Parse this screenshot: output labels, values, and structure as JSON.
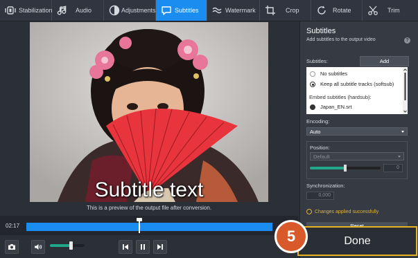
{
  "toolbar": {
    "items": [
      {
        "label": "Stabilization",
        "icon": "stabilization-icon"
      },
      {
        "label": "Audio",
        "icon": "music-note-icon"
      },
      {
        "label": "Adjustments",
        "icon": "contrast-icon"
      },
      {
        "label": "Subtitles",
        "icon": "speech-bubble-icon",
        "active": true
      },
      {
        "label": "Watermark",
        "icon": "watermark-icon"
      },
      {
        "label": "Crop",
        "icon": "crop-icon"
      },
      {
        "label": "Rotate",
        "icon": "rotate-icon"
      },
      {
        "label": "Trim",
        "icon": "scissors-icon"
      }
    ]
  },
  "preview": {
    "subtitle_text": "Subtitle text",
    "caption": "This is a preview of the output file after conversion."
  },
  "timeline": {
    "time": "02:17",
    "position": 0.46
  },
  "controls": {
    "volume_level": 0.6
  },
  "panel": {
    "title": "Subtitles",
    "subtitle": "Add subtitles to the output video",
    "help": "?",
    "subtitles_label": "Subtitles:",
    "add_button": "Add",
    "options": [
      {
        "label": "No subtitles",
        "state": "off"
      },
      {
        "label": "Keep all subtitle tracks (softsub)",
        "state": "on"
      }
    ],
    "embed_header": "Embed subtitles (hardsub):",
    "embed_items": [
      {
        "label": "Japan_EN.srt"
      }
    ],
    "encoding_label": "Encoding:",
    "encoding_value": "Auto",
    "position_label": "Position:",
    "position_value": "Default",
    "position_slider": 0.5,
    "position_number": "0",
    "sync_label": "Synchronization:",
    "sync_value": "0,000",
    "status": "Changes applied successfully",
    "reset_button": "Reset"
  },
  "done": {
    "label": "Done",
    "step_number": "5"
  },
  "colors": {
    "accent": "#1b8cf0",
    "highlight": "#e8b321",
    "step_badge": "#d85a2a",
    "slider_fill": "#1fa88c"
  }
}
